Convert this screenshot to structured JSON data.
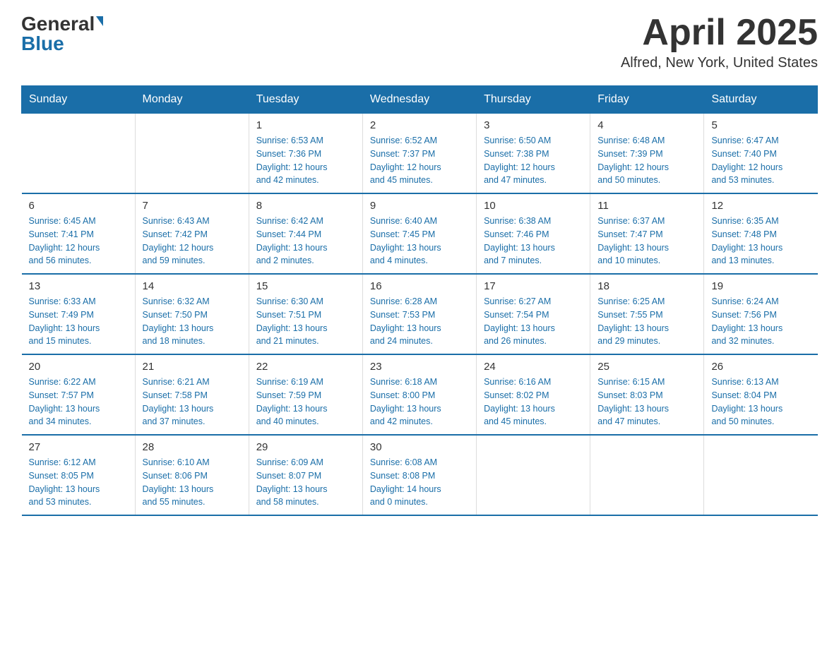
{
  "header": {
    "logo_line1": "General",
    "logo_line2": "Blue",
    "month_title": "April 2025",
    "location": "Alfred, New York, United States"
  },
  "weekdays": [
    "Sunday",
    "Monday",
    "Tuesday",
    "Wednesday",
    "Thursday",
    "Friday",
    "Saturday"
  ],
  "weeks": [
    [
      {
        "day": "",
        "info": ""
      },
      {
        "day": "",
        "info": ""
      },
      {
        "day": "1",
        "info": "Sunrise: 6:53 AM\nSunset: 7:36 PM\nDaylight: 12 hours\nand 42 minutes."
      },
      {
        "day": "2",
        "info": "Sunrise: 6:52 AM\nSunset: 7:37 PM\nDaylight: 12 hours\nand 45 minutes."
      },
      {
        "day": "3",
        "info": "Sunrise: 6:50 AM\nSunset: 7:38 PM\nDaylight: 12 hours\nand 47 minutes."
      },
      {
        "day": "4",
        "info": "Sunrise: 6:48 AM\nSunset: 7:39 PM\nDaylight: 12 hours\nand 50 minutes."
      },
      {
        "day": "5",
        "info": "Sunrise: 6:47 AM\nSunset: 7:40 PM\nDaylight: 12 hours\nand 53 minutes."
      }
    ],
    [
      {
        "day": "6",
        "info": "Sunrise: 6:45 AM\nSunset: 7:41 PM\nDaylight: 12 hours\nand 56 minutes."
      },
      {
        "day": "7",
        "info": "Sunrise: 6:43 AM\nSunset: 7:42 PM\nDaylight: 12 hours\nand 59 minutes."
      },
      {
        "day": "8",
        "info": "Sunrise: 6:42 AM\nSunset: 7:44 PM\nDaylight: 13 hours\nand 2 minutes."
      },
      {
        "day": "9",
        "info": "Sunrise: 6:40 AM\nSunset: 7:45 PM\nDaylight: 13 hours\nand 4 minutes."
      },
      {
        "day": "10",
        "info": "Sunrise: 6:38 AM\nSunset: 7:46 PM\nDaylight: 13 hours\nand 7 minutes."
      },
      {
        "day": "11",
        "info": "Sunrise: 6:37 AM\nSunset: 7:47 PM\nDaylight: 13 hours\nand 10 minutes."
      },
      {
        "day": "12",
        "info": "Sunrise: 6:35 AM\nSunset: 7:48 PM\nDaylight: 13 hours\nand 13 minutes."
      }
    ],
    [
      {
        "day": "13",
        "info": "Sunrise: 6:33 AM\nSunset: 7:49 PM\nDaylight: 13 hours\nand 15 minutes."
      },
      {
        "day": "14",
        "info": "Sunrise: 6:32 AM\nSunset: 7:50 PM\nDaylight: 13 hours\nand 18 minutes."
      },
      {
        "day": "15",
        "info": "Sunrise: 6:30 AM\nSunset: 7:51 PM\nDaylight: 13 hours\nand 21 minutes."
      },
      {
        "day": "16",
        "info": "Sunrise: 6:28 AM\nSunset: 7:53 PM\nDaylight: 13 hours\nand 24 minutes."
      },
      {
        "day": "17",
        "info": "Sunrise: 6:27 AM\nSunset: 7:54 PM\nDaylight: 13 hours\nand 26 minutes."
      },
      {
        "day": "18",
        "info": "Sunrise: 6:25 AM\nSunset: 7:55 PM\nDaylight: 13 hours\nand 29 minutes."
      },
      {
        "day": "19",
        "info": "Sunrise: 6:24 AM\nSunset: 7:56 PM\nDaylight: 13 hours\nand 32 minutes."
      }
    ],
    [
      {
        "day": "20",
        "info": "Sunrise: 6:22 AM\nSunset: 7:57 PM\nDaylight: 13 hours\nand 34 minutes."
      },
      {
        "day": "21",
        "info": "Sunrise: 6:21 AM\nSunset: 7:58 PM\nDaylight: 13 hours\nand 37 minutes."
      },
      {
        "day": "22",
        "info": "Sunrise: 6:19 AM\nSunset: 7:59 PM\nDaylight: 13 hours\nand 40 minutes."
      },
      {
        "day": "23",
        "info": "Sunrise: 6:18 AM\nSunset: 8:00 PM\nDaylight: 13 hours\nand 42 minutes."
      },
      {
        "day": "24",
        "info": "Sunrise: 6:16 AM\nSunset: 8:02 PM\nDaylight: 13 hours\nand 45 minutes."
      },
      {
        "day": "25",
        "info": "Sunrise: 6:15 AM\nSunset: 8:03 PM\nDaylight: 13 hours\nand 47 minutes."
      },
      {
        "day": "26",
        "info": "Sunrise: 6:13 AM\nSunset: 8:04 PM\nDaylight: 13 hours\nand 50 minutes."
      }
    ],
    [
      {
        "day": "27",
        "info": "Sunrise: 6:12 AM\nSunset: 8:05 PM\nDaylight: 13 hours\nand 53 minutes."
      },
      {
        "day": "28",
        "info": "Sunrise: 6:10 AM\nSunset: 8:06 PM\nDaylight: 13 hours\nand 55 minutes."
      },
      {
        "day": "29",
        "info": "Sunrise: 6:09 AM\nSunset: 8:07 PM\nDaylight: 13 hours\nand 58 minutes."
      },
      {
        "day": "30",
        "info": "Sunrise: 6:08 AM\nSunset: 8:08 PM\nDaylight: 14 hours\nand 0 minutes."
      },
      {
        "day": "",
        "info": ""
      },
      {
        "day": "",
        "info": ""
      },
      {
        "day": "",
        "info": ""
      }
    ]
  ]
}
